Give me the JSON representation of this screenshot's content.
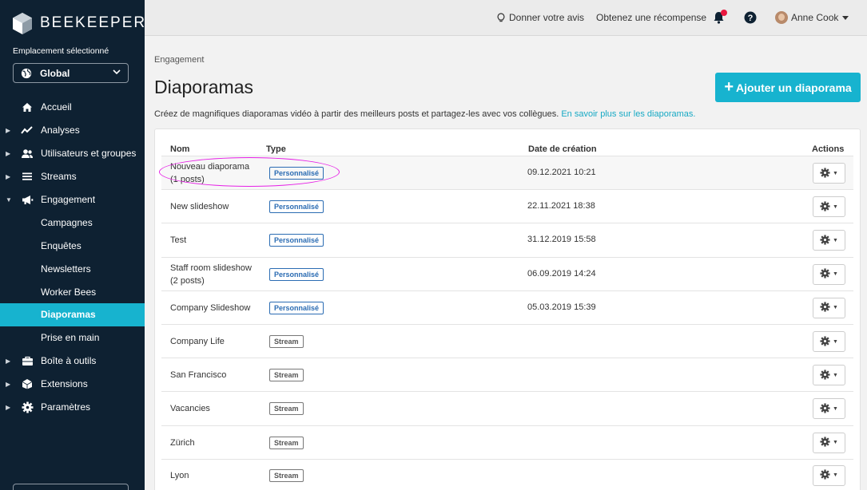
{
  "brand": {
    "name": "BEEKEEPER"
  },
  "location": {
    "label": "Emplacement sélectionné",
    "value": "Global"
  },
  "nav": [
    {
      "label": "Accueil",
      "icon": "home-icon",
      "caret": ""
    },
    {
      "label": "Analyses",
      "icon": "chart-line-icon",
      "caret": "▶"
    },
    {
      "label": "Utilisateurs et groupes",
      "icon": "users-icon",
      "caret": "▶"
    },
    {
      "label": "Streams",
      "icon": "list-icon",
      "caret": "▶"
    },
    {
      "label": "Engagement",
      "icon": "megaphone-icon",
      "caret": "▼"
    },
    {
      "label": "Campagnes",
      "icon": "",
      "caret": ""
    },
    {
      "label": "Enquêtes",
      "icon": "",
      "caret": ""
    },
    {
      "label": "Newsletters",
      "icon": "",
      "caret": ""
    },
    {
      "label": "Worker Bees",
      "icon": "",
      "caret": ""
    },
    {
      "label": "Diaporamas",
      "icon": "",
      "caret": "",
      "active": true
    },
    {
      "label": "Prise en main",
      "icon": "",
      "caret": ""
    },
    {
      "label": "Boîte à outils",
      "icon": "toolbox-icon",
      "caret": "▶"
    },
    {
      "label": "Extensions",
      "icon": "puzzle-icon",
      "caret": "▶"
    },
    {
      "label": "Paramètres",
      "icon": "gear-icon",
      "caret": "▶"
    }
  ],
  "topbar": {
    "feedback": "Donner votre avis",
    "reward": "Obtenez une récompense",
    "user": "Anne Cook"
  },
  "page": {
    "breadcrumb": "Engagement",
    "title": "Diaporamas",
    "add_button": "Ajouter un diaporama",
    "description": "Créez de magnifiques diaporamas vidéo à partir des meilleurs posts et partagez-les avec vos collègues.",
    "learn_more": "En savoir plus sur les diaporamas."
  },
  "table": {
    "headers": {
      "name": "Nom",
      "type": "Type",
      "date": "Date de création",
      "actions": "Actions"
    },
    "rows": [
      {
        "name": "Nouveau diaporama",
        "sub": "(1 posts)",
        "type": "Personnalisé",
        "date": "09.12.2021 10:21",
        "highlighted": true
      },
      {
        "name": "New slideshow",
        "sub": "",
        "type": "Personnalisé",
        "date": "22.11.2021 18:38"
      },
      {
        "name": "Test",
        "sub": "",
        "type": "Personnalisé",
        "date": "31.12.2019 15:58"
      },
      {
        "name": "Staff room slideshow",
        "sub": "(2 posts)",
        "type": "Personnalisé",
        "date": "06.09.2019 14:24"
      },
      {
        "name": "Company Slideshow",
        "sub": "",
        "type": "Personnalisé",
        "date": "05.03.2019 15:39"
      },
      {
        "name": "Company Life",
        "sub": "",
        "type": "Stream",
        "date": ""
      },
      {
        "name": "San Francisco",
        "sub": "",
        "type": "Stream",
        "date": ""
      },
      {
        "name": "Vacancies",
        "sub": "",
        "type": "Stream",
        "date": ""
      },
      {
        "name": "Zürich",
        "sub": "",
        "type": "Stream",
        "date": ""
      },
      {
        "name": "Lyon",
        "sub": "",
        "type": "Stream",
        "date": ""
      }
    ]
  },
  "colors": {
    "sidebar": "#0e2132",
    "accent": "#17b3cf",
    "badge_custom": "#2b6cb3",
    "notification": "#e8173f",
    "annotation": "#e620e6"
  }
}
